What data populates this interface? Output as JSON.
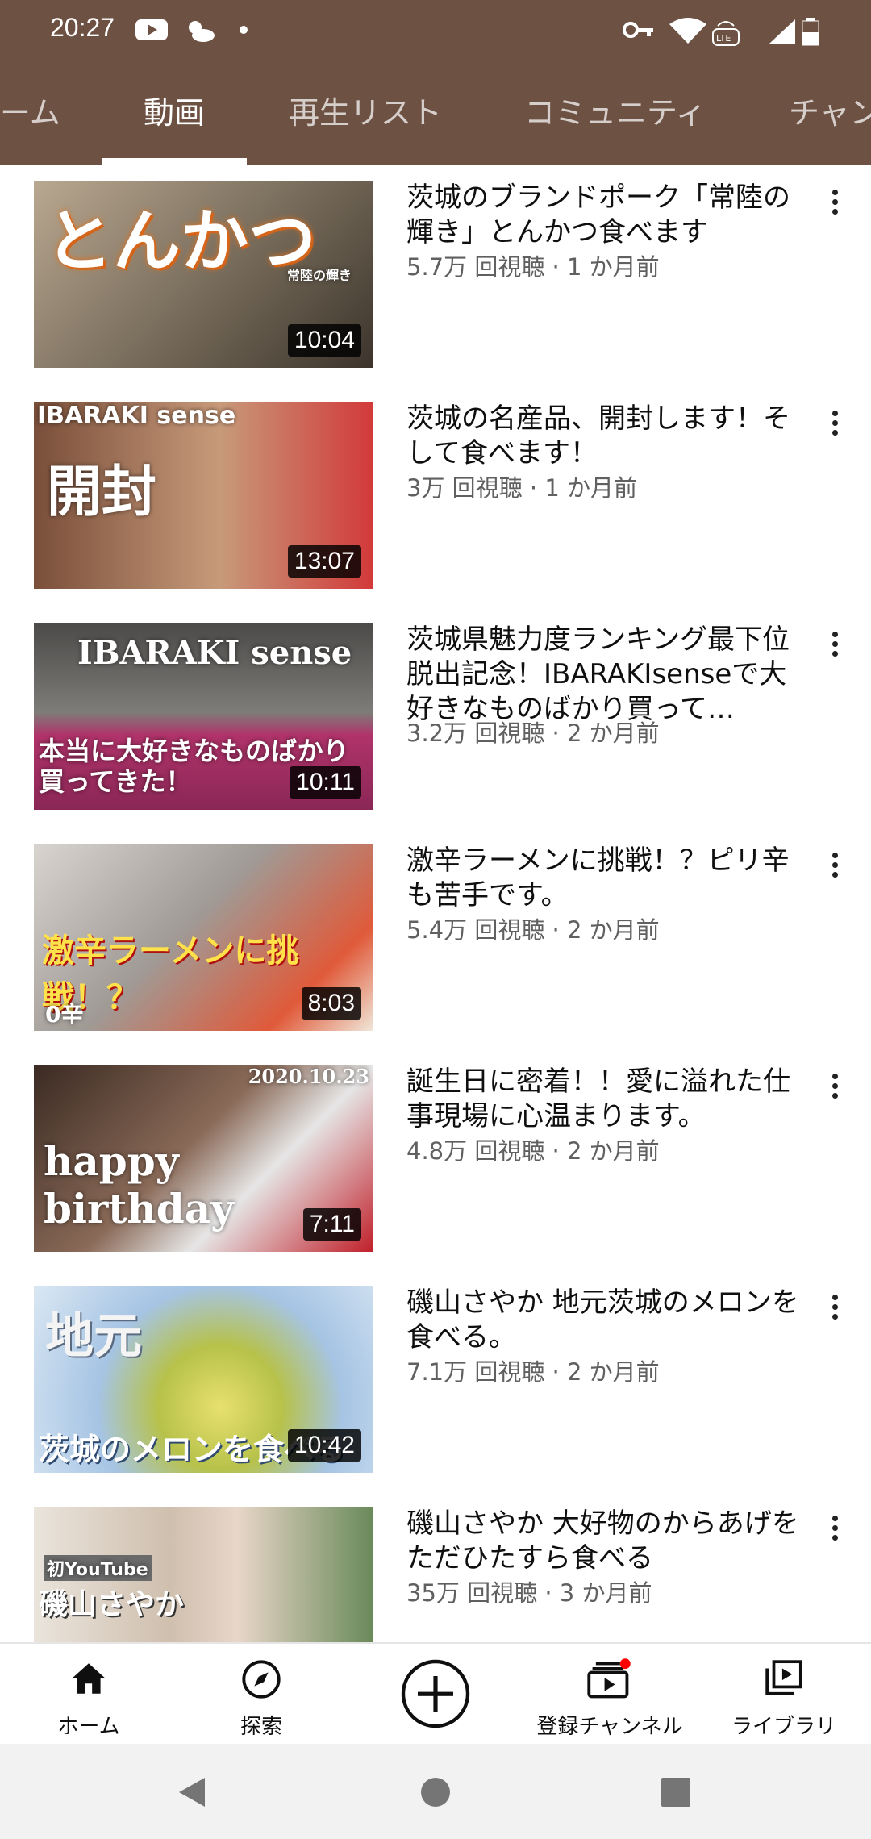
{
  "status_bar": {
    "time": "20:27"
  },
  "tabs": [
    {
      "label": "ーム",
      "active": false
    },
    {
      "label": "動画",
      "active": true
    },
    {
      "label": "再生リスト",
      "active": false
    },
    {
      "label": "コミュニティ",
      "active": false
    },
    {
      "label": "チャン",
      "active": false
    }
  ],
  "videos": [
    {
      "title": "茨城のブランドポーク「常陸の輝き」とんかつ食べます",
      "views": "5.7万 回視聴",
      "age": "1 か月前",
      "duration": "10:04",
      "thumb_text": "とんかつ",
      "thumb_sub": "常陸の輝き"
    },
    {
      "title": "茨城の名産品、開封します！そして食べます！",
      "views": "3万 回視聴",
      "age": "1 か月前",
      "duration": "13:07",
      "thumb_text": "開封",
      "thumb_sub": "IBARAKI sense"
    },
    {
      "title": "茨城県魅力度ランキング最下位脱出記念！IBARAKIsenseで大好きなものばかり買って…",
      "views": "3.2万 回視聴",
      "age": "2 か月前",
      "duration": "10:11",
      "thumb_text": "本当に大好きなものばかり買ってきた！",
      "thumb_sub": "IBARAKI sense"
    },
    {
      "title": "激辛ラーメンに挑戦！？ピリ辛も苦手です。",
      "views": "5.4万 回視聴",
      "age": "2 か月前",
      "duration": "8:03",
      "thumb_text": "激辛ラーメンに挑戦！？",
      "thumb_sub": "0辛"
    },
    {
      "title": "誕生日に密着！！愛に溢れた仕事現場に心温まります。",
      "views": "4.8万 回視聴",
      "age": "2 か月前",
      "duration": "7:11",
      "thumb_text": "happy birthday",
      "thumb_sub": "2020.10.23"
    },
    {
      "title": "磯山さやか 地元茨城のメロンを食べる。",
      "views": "7.1万 回視聴",
      "age": "2 か月前",
      "duration": "10:42",
      "thumb_text": "地元",
      "thumb_sub": "茨城のメロンを食べる"
    },
    {
      "title": "磯山さやか 大好物のからあげをただひたすら食べる",
      "views": "35万 回視聴",
      "age": "3 か月前",
      "duration": "",
      "thumb_text": "磯山さやか",
      "thumb_sub": "初YouTube"
    }
  ],
  "meta_separator": " · ",
  "bottom_nav": [
    {
      "label": "ホーム",
      "icon": "home-icon"
    },
    {
      "label": "探索",
      "icon": "explore-icon"
    },
    {
      "label": "",
      "icon": "create-icon"
    },
    {
      "label": "登録チャンネル",
      "icon": "subscriptions-icon"
    },
    {
      "label": "ライブラリ",
      "icon": "library-icon"
    }
  ],
  "colors": {
    "header": "#6d5142",
    "accent_red": "#ff0000"
  }
}
